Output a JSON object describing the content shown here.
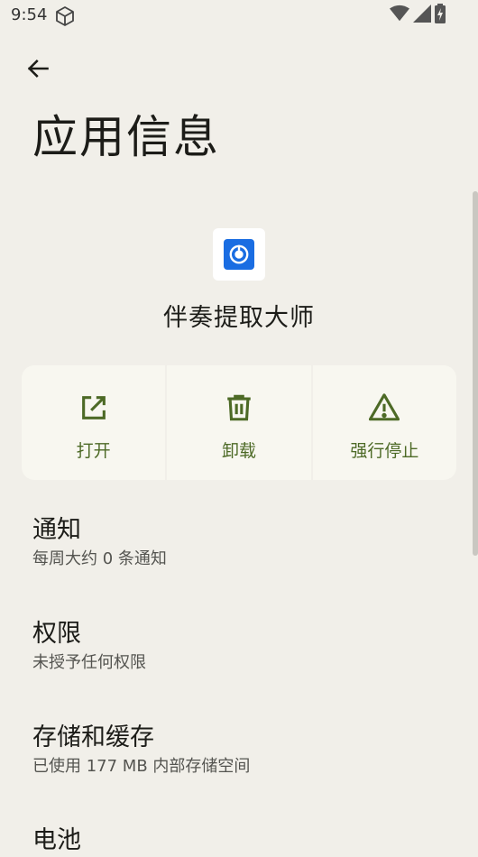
{
  "status_bar": {
    "time": "9:54",
    "icons": [
      "box-icon",
      "wifi-icon",
      "signal-icon",
      "battery-charging-icon"
    ]
  },
  "header": {
    "back_icon": "arrow-left-icon",
    "title": "应用信息"
  },
  "app": {
    "name": "伴奏提取大师",
    "icon_color": "#1a6de2"
  },
  "actions": [
    {
      "label": "打开",
      "icon": "open-external-icon"
    },
    {
      "label": "卸载",
      "icon": "trash-icon"
    },
    {
      "label": "强行停止",
      "icon": "warning-icon"
    }
  ],
  "settings": [
    {
      "title": "通知",
      "subtitle": "每周大约 0 条通知"
    },
    {
      "title": "权限",
      "subtitle": "未授予任何权限"
    },
    {
      "title": "存储和缓存",
      "subtitle": "已使用 177 MB 内部存储空间"
    },
    {
      "title": "电池",
      "subtitle": ""
    }
  ],
  "colors": {
    "background": "#f1efe9",
    "accent": "#4d6a26",
    "action_bg": "#f8f7f0"
  }
}
